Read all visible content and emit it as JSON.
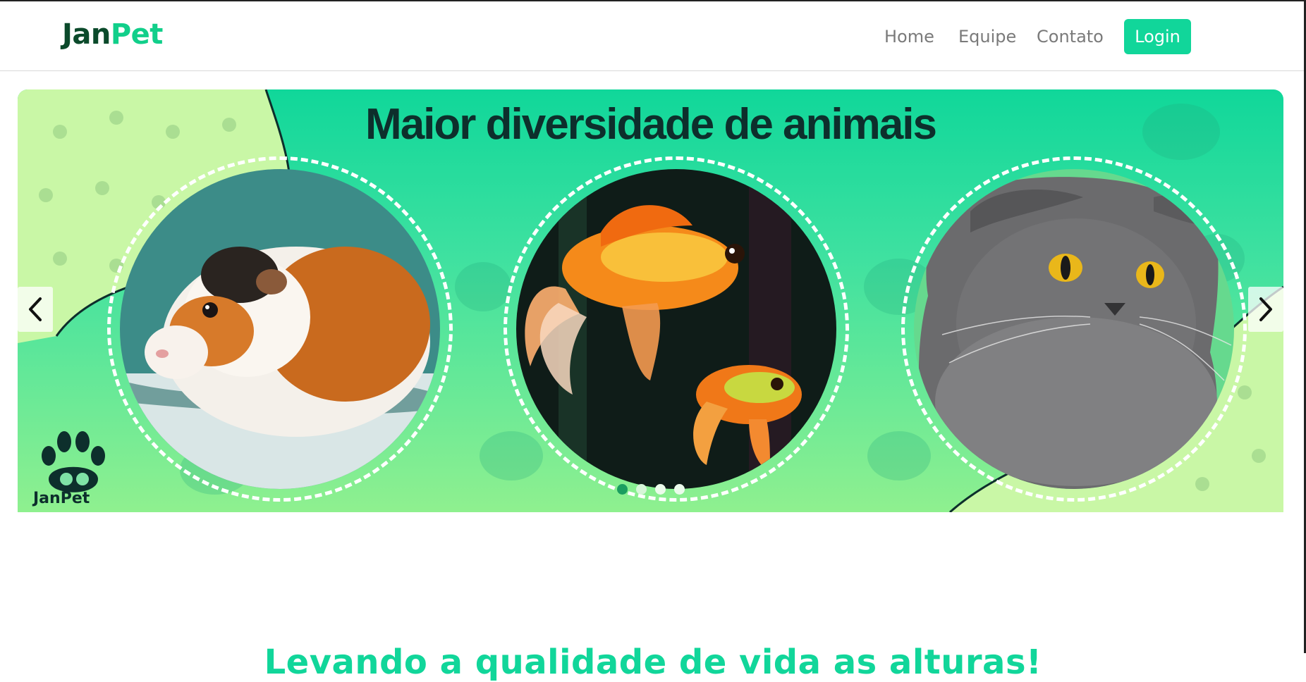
{
  "brand": {
    "part1": "Jan",
    "part2": "Pet"
  },
  "nav": {
    "home": "Home",
    "team": "Equipe",
    "contact": "Contato",
    "login": "Login"
  },
  "carousel": {
    "title": "Maior diversidade de animais",
    "slides": [
      "guinea-pig-photo",
      "goldfish-photo",
      "gray-cat-photo"
    ],
    "active_index": 0,
    "indicator_count": 4,
    "prev_icon": "chevron-left-icon",
    "next_icon": "chevron-right-icon",
    "logo_text": "JanPet"
  },
  "tagline": "Levando a qualidade de vida as alturas!",
  "colors": {
    "accent": "#11d69a",
    "brand_dark": "#0b4a2b",
    "title_dark": "#0d2f2c"
  }
}
